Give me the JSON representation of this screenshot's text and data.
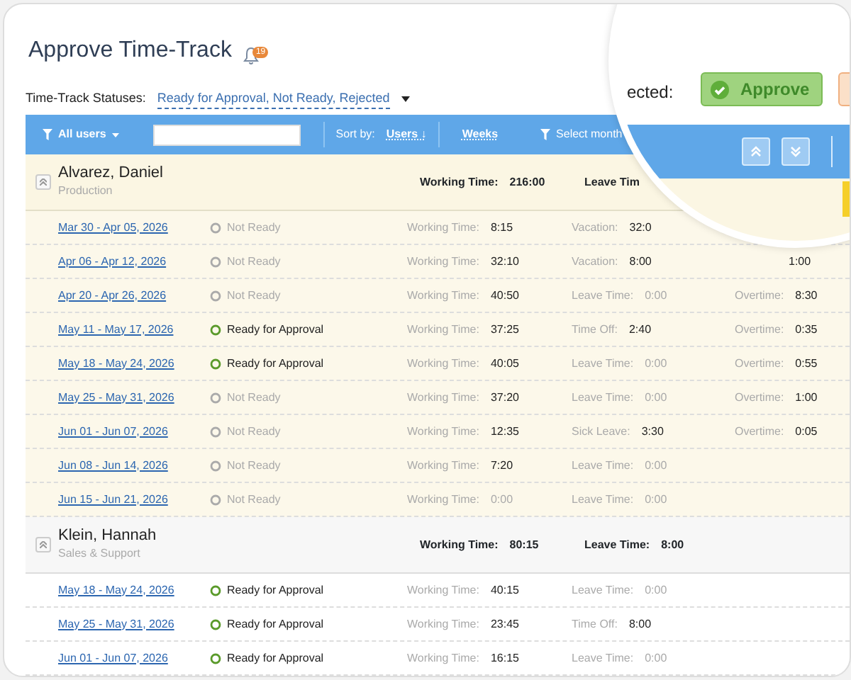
{
  "title": "Approve Time-Track",
  "notifications": {
    "count": "19"
  },
  "statuses": {
    "label": "Time-Track Statuses:",
    "value": "Ready for Approval, Not Ready, Rejected"
  },
  "toolbar": {
    "users_filter": "All users",
    "sort_label": "Sort by:",
    "sort_value": "Users",
    "sort_direction": "↓",
    "grouping": "Weeks",
    "month_filter": "Select month"
  },
  "magnifier": {
    "selected_label": "ected:",
    "approve_button": "Approve"
  },
  "groups": [
    {
      "name": "Alvarez, Daniel",
      "department": "Production",
      "expanded": true,
      "selected": true,
      "totals": [
        {
          "label": "Working Time:",
          "value": "216:00"
        },
        {
          "label": "Leave Tim"
        }
      ],
      "rows": [
        {
          "period": "Mar 30 - Apr 05, 2026",
          "status": "Not Ready",
          "ready": false,
          "fields": [
            {
              "label": "Working Time:",
              "value": "8:15",
              "muted": false
            },
            {
              "label": "Vacation:",
              "value": "32:0",
              "muted": false
            }
          ]
        },
        {
          "period": "Apr 06 - Apr 12, 2026",
          "status": "Not Ready",
          "ready": false,
          "fields": [
            {
              "label": "Working Time:",
              "value": "32:10",
              "muted": false
            },
            {
              "label": "Vacation:",
              "value": "8:00",
              "muted": false
            },
            {
              "value": "1:00",
              "muted": false
            }
          ]
        },
        {
          "period": "Apr 20 - Apr 26, 2026",
          "status": "Not Ready",
          "ready": false,
          "fields": [
            {
              "label": "Working Time:",
              "value": "40:50",
              "muted": false
            },
            {
              "label": "Leave Time:",
              "value": "0:00",
              "muted": true
            },
            {
              "label": "Overtime:",
              "value": "8:30",
              "muted": false
            }
          ]
        },
        {
          "period": "May 11 - May 17, 2026",
          "status": "Ready for Approval",
          "ready": true,
          "fields": [
            {
              "label": "Working Time:",
              "value": "37:25",
              "muted": false
            },
            {
              "label": "Time Off:",
              "value": "2:40",
              "muted": false
            },
            {
              "label": "Overtime:",
              "value": "0:35",
              "muted": false
            }
          ]
        },
        {
          "period": "May 18 - May 24, 2026",
          "status": "Ready for Approval",
          "ready": true,
          "fields": [
            {
              "label": "Working Time:",
              "value": "40:05",
              "muted": false
            },
            {
              "label": "Leave Time:",
              "value": "0:00",
              "muted": true
            },
            {
              "label": "Overtime:",
              "value": "0:55",
              "muted": false
            }
          ]
        },
        {
          "period": "May 25 - May 31, 2026",
          "status": "Not Ready",
          "ready": false,
          "fields": [
            {
              "label": "Working Time:",
              "value": "37:20",
              "muted": false
            },
            {
              "label": "Leave Time:",
              "value": "0:00",
              "muted": true
            },
            {
              "label": "Overtime:",
              "value": "1:00",
              "muted": false
            }
          ]
        },
        {
          "period": "Jun 01 - Jun 07, 2026",
          "status": "Not Ready",
          "ready": false,
          "fields": [
            {
              "label": "Working Time:",
              "value": "12:35",
              "muted": false
            },
            {
              "label": "Sick Leave:",
              "value": "3:30",
              "muted": false
            },
            {
              "label": "Overtime:",
              "value": "0:05",
              "muted": false
            }
          ]
        },
        {
          "period": "Jun 08 - Jun 14, 2026",
          "status": "Not Ready",
          "ready": false,
          "fields": [
            {
              "label": "Working Time:",
              "value": "7:20",
              "muted": false
            },
            {
              "label": "Leave Time:",
              "value": "0:00",
              "muted": true
            }
          ]
        },
        {
          "period": "Jun 15 - Jun 21, 2026",
          "status": "Not Ready",
          "ready": false,
          "fields": [
            {
              "label": "Working Time:",
              "value": "0:00",
              "muted": true
            },
            {
              "label": "Leave Time:",
              "value": "0:00",
              "muted": true
            }
          ]
        }
      ]
    },
    {
      "name": "Klein, Hannah",
      "department": "Sales & Support",
      "expanded": true,
      "selected": false,
      "totals": [
        {
          "label": "Working Time:",
          "value": "80:15"
        },
        {
          "label": "Leave Time:",
          "value": "8:00"
        }
      ],
      "rows": [
        {
          "period": "May 18 - May 24, 2026",
          "status": "Ready for Approval",
          "ready": true,
          "fields": [
            {
              "label": "Working Time:",
              "value": "40:15",
              "muted": false
            },
            {
              "label": "Leave Time:",
              "value": "0:00",
              "muted": true
            }
          ]
        },
        {
          "period": "May 25 - May 31, 2026",
          "status": "Ready for Approval",
          "ready": true,
          "fields": [
            {
              "label": "Working Time:",
              "value": "23:45",
              "muted": false
            },
            {
              "label": "Time Off:",
              "value": "8:00",
              "muted": false
            }
          ]
        },
        {
          "period": "Jun 01 - Jun 07, 2026",
          "status": "Ready for Approval",
          "ready": true,
          "fields": [
            {
              "label": "Working Time:",
              "value": "16:15",
              "muted": false
            },
            {
              "label": "Leave Time:",
              "value": "0:00",
              "muted": true
            }
          ]
        }
      ]
    }
  ]
}
